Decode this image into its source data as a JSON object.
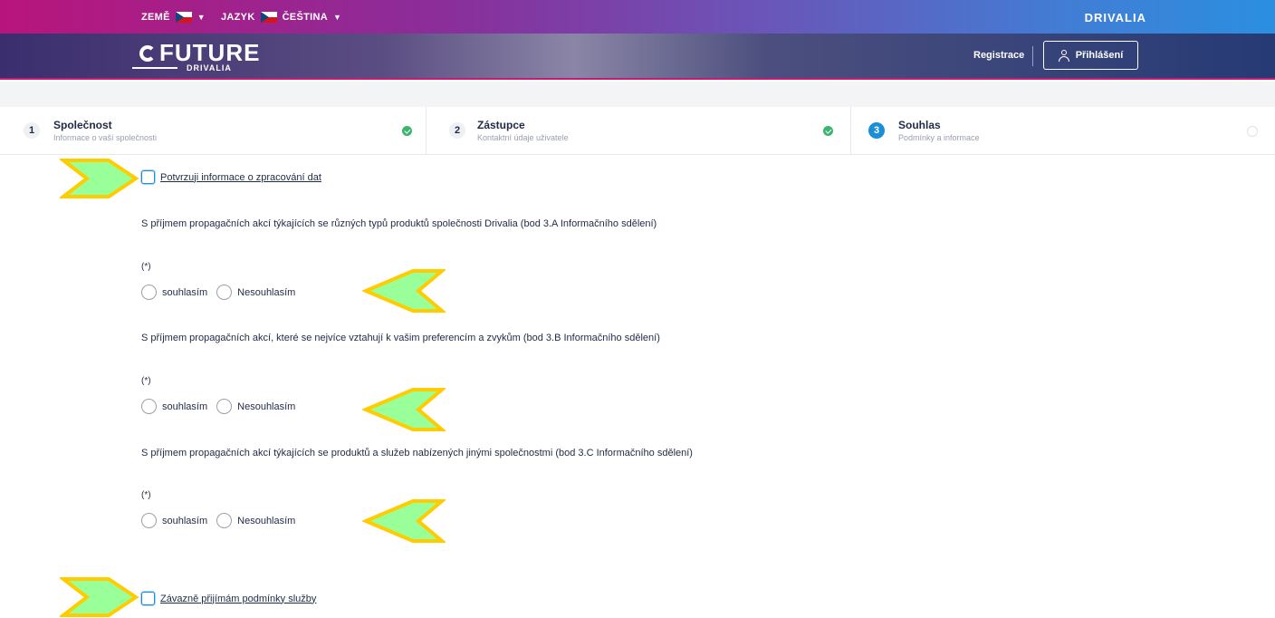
{
  "topbar": {
    "country_label": "ZEMĚ",
    "language_label": "JAZYK",
    "language_value": "ČEŠTINA",
    "brand": "DRIVALIA"
  },
  "header": {
    "logo_main": "FUTURE",
    "logo_sub": "DRIVALIA",
    "register_label": "Registrace",
    "login_label": "Přihlášení"
  },
  "steps": [
    {
      "number": "1",
      "title": "Společnost",
      "subtitle": "Informace o vaší společnosti",
      "status": "done"
    },
    {
      "number": "2",
      "title": "Zástupce",
      "subtitle": "Kontaktní údaje uživatele",
      "status": "done"
    },
    {
      "number": "3",
      "title": "Souhlas",
      "subtitle": "Podmínky a informace",
      "status": "active"
    }
  ],
  "consent": {
    "data_processing_label": "Potvrzuji informace o zpracování dat",
    "questions": [
      {
        "text": "S příjmem propagačních akcí týkajících se různých typů produktů společnosti Drivalia (bod 3.A Informačního sdělení)",
        "required": "(*)",
        "agree": "souhlasím",
        "disagree": "Nesouhlasím"
      },
      {
        "text": "S příjmem propagačních akcí, které se nejvíce vztahují k vašim preferencím a zvykům (bod 3.B Informačního sdělení)",
        "required": "(*)",
        "agree": "souhlasím",
        "disagree": "Nesouhlasím"
      },
      {
        "text": "S příjmem propagačních akcí týkajících se produktů a služeb nabízených jinými společnostmi (bod 3.C Informačního sdělení)",
        "required": "(*)",
        "agree": "souhlasím",
        "disagree": "Nesouhlasím"
      }
    ],
    "terms_label": "Závazně přijímám podmínky služby"
  },
  "colors": {
    "accent": "#1a8fd8",
    "success": "#3cb371",
    "arrow_fill": "#99ff99",
    "arrow_border": "#ffcc00"
  }
}
